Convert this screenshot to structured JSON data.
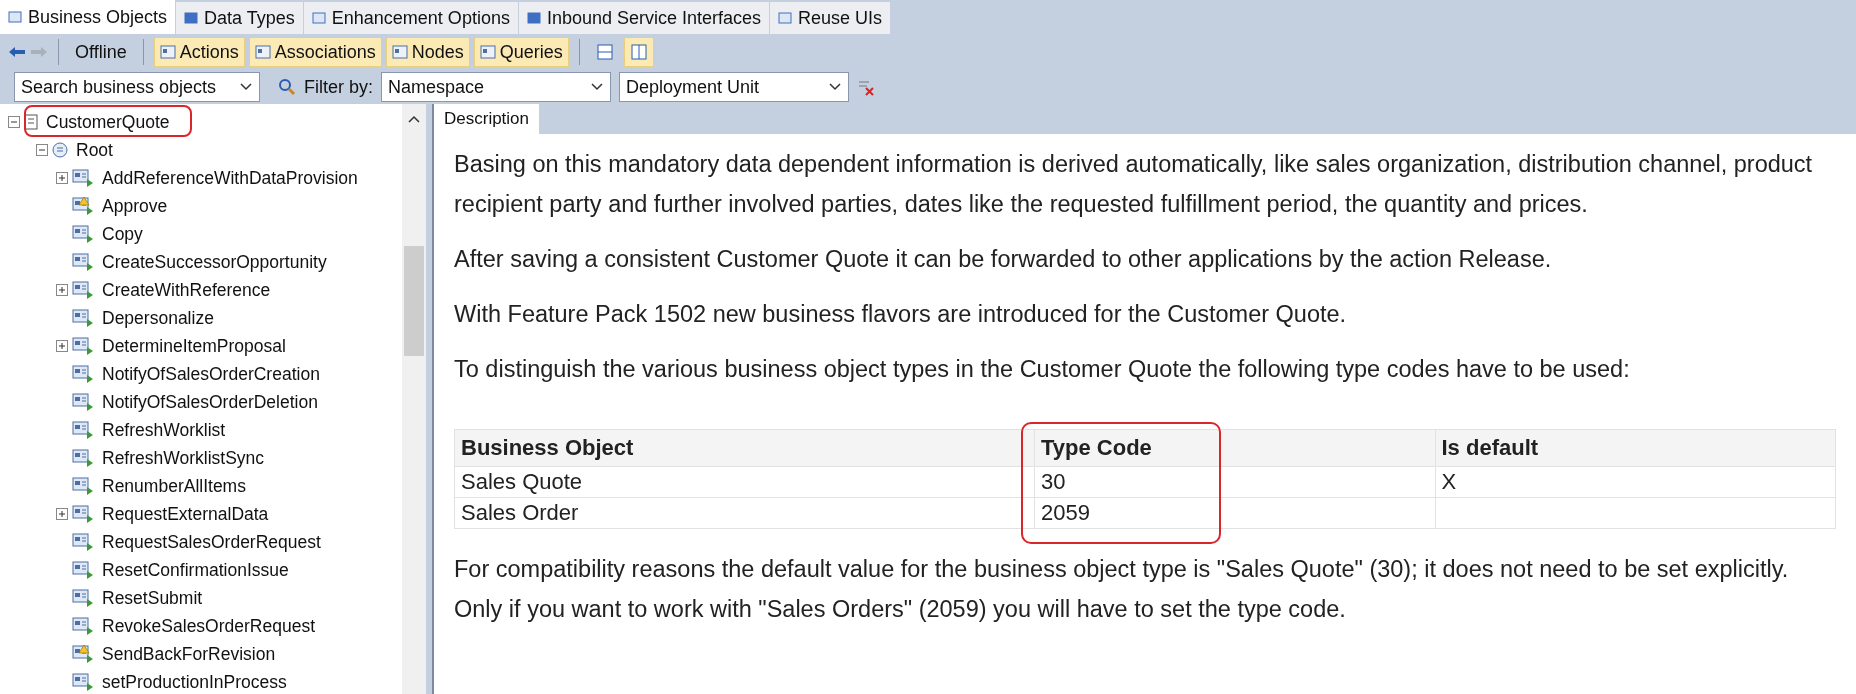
{
  "tabs": [
    {
      "label": "Business Objects",
      "selected": true
    },
    {
      "label": "Data Types",
      "selected": false
    },
    {
      "label": "Enhancement Options",
      "selected": false
    },
    {
      "label": "Inbound Service Interfaces",
      "selected": false
    },
    {
      "label": "Reuse UIs",
      "selected": false
    }
  ],
  "toolbar": {
    "mode": "Offline",
    "filters": [
      {
        "label": "Actions",
        "selected": true
      },
      {
        "label": "Associations",
        "selected": true
      },
      {
        "label": "Nodes",
        "selected": true
      },
      {
        "label": "Queries",
        "selected": true
      }
    ],
    "views": [
      {
        "selected": false
      },
      {
        "selected": true
      }
    ]
  },
  "filter_row": {
    "search": "Search business objects",
    "filter_label": "Filter by:",
    "namespace": "Namespace",
    "deployment_unit": "Deployment Unit"
  },
  "tree": {
    "label": "CustomerQuote",
    "expanded": true,
    "highlighted": true,
    "children": [
      {
        "label": "Root",
        "expanded": true,
        "children": [
          {
            "label": "AddReferenceWithDataProvision",
            "expandable": true,
            "warning": false
          },
          {
            "label": "Approve",
            "expandable": false,
            "warning": true
          },
          {
            "label": "Copy",
            "expandable": false,
            "warning": false
          },
          {
            "label": "CreateSuccessorOpportunity",
            "expandable": false,
            "warning": false
          },
          {
            "label": "CreateWithReference",
            "expandable": true,
            "warning": false
          },
          {
            "label": "Depersonalize",
            "expandable": false,
            "warning": false
          },
          {
            "label": "DetermineItemProposal",
            "expandable": true,
            "warning": false
          },
          {
            "label": "NotifyOfSalesOrderCreation",
            "expandable": false,
            "warning": false
          },
          {
            "label": "NotifyOfSalesOrderDeletion",
            "expandable": false,
            "warning": false
          },
          {
            "label": "RefreshWorklist",
            "expandable": false,
            "warning": false
          },
          {
            "label": "RefreshWorklistSync",
            "expandable": false,
            "warning": false
          },
          {
            "label": "RenumberAllItems",
            "expandable": false,
            "warning": false
          },
          {
            "label": "RequestExternalData",
            "expandable": true,
            "warning": false
          },
          {
            "label": "RequestSalesOrderRequest",
            "expandable": false,
            "warning": false
          },
          {
            "label": "ResetConfirmationIssue",
            "expandable": false,
            "warning": false
          },
          {
            "label": "ResetSubmit",
            "expandable": false,
            "warning": false
          },
          {
            "label": "RevokeSalesOrderRequest",
            "expandable": false,
            "warning": false
          },
          {
            "label": "SendBackForRevision",
            "expandable": false,
            "warning": true
          },
          {
            "label": "setProductionInProcess",
            "expandable": false,
            "warning": false
          }
        ]
      }
    ]
  },
  "description": {
    "tab": "Description",
    "paragraphs_before": [
      "Basing on this mandatory data dependent information is derived automatically, like sales organization, distribution channel, product recipient party and further involved parties, dates like the requested fulfillment period, the quantity and prices.",
      "After saving a consistent Customer Quote it can be forwarded to other applications by the action Release.",
      "With Feature Pack 1502 new business flavors are introduced for the Customer Quote.",
      "To distinguish the various business object types in the Customer Quote the following type codes have to be used:"
    ],
    "table": {
      "columns": [
        {
          "label": "Business Object",
          "highlighted": false
        },
        {
          "label": "Type Code",
          "highlighted": true
        },
        {
          "label": "Is default",
          "highlighted": false
        }
      ],
      "rows": [
        [
          "Sales Quote",
          "30",
          "X"
        ],
        [
          "Sales Order",
          "2059",
          ""
        ]
      ]
    },
    "paragraphs_after": [
      "For compatibility reasons the default value for the business object type is \"Sales Quote\" (30); it does not need to be set explicitly. Only if you want to work with \"Sales Orders\" (2059) you will have to set the type code."
    ]
  }
}
